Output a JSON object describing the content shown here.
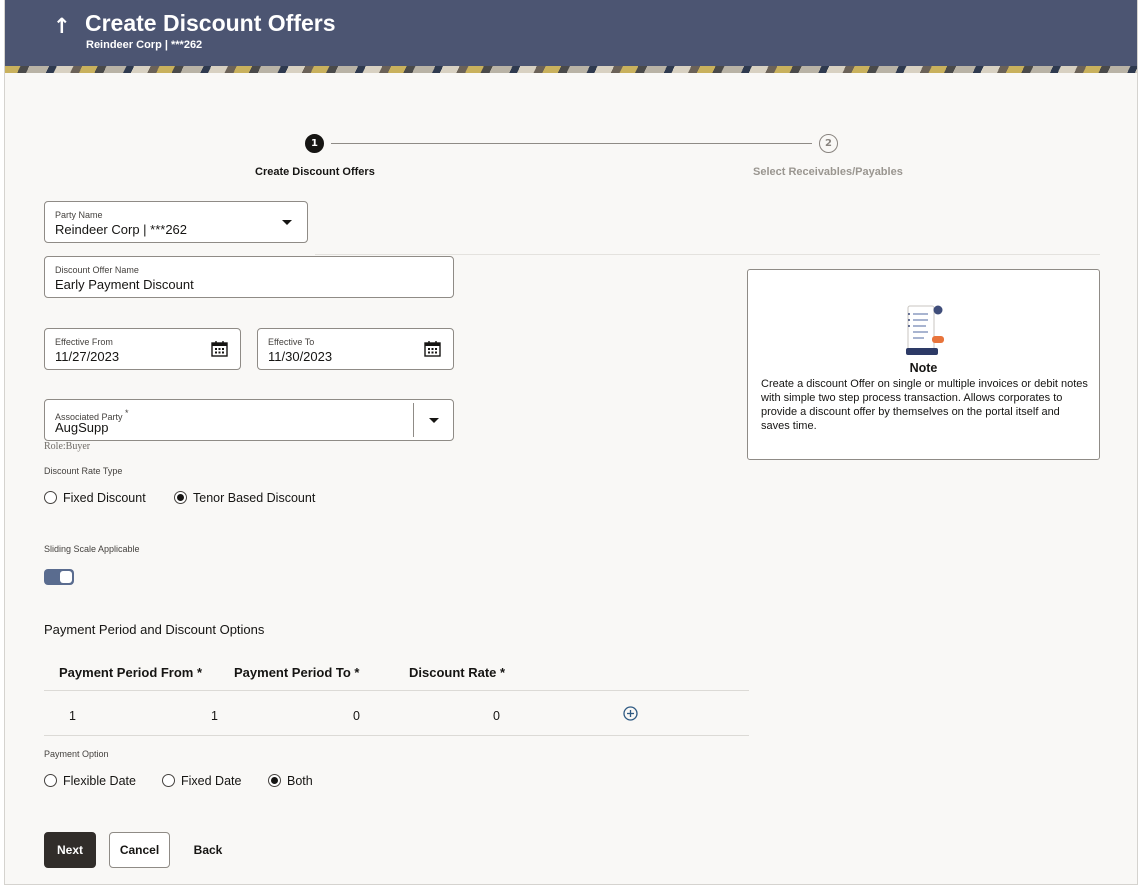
{
  "header": {
    "back_icon": "up-arrow-icon",
    "back_glyph": "↑",
    "title": "Create Discount Offers",
    "subtitle": "Reindeer Corp | ***262",
    "background": "#4c5572"
  },
  "stepper": {
    "steps": [
      {
        "number": "1",
        "label": "Create Discount Offers",
        "state": "active"
      },
      {
        "number": "2",
        "label": "Select Receivables/Payables",
        "state": "inactive"
      }
    ]
  },
  "form": {
    "party_name": {
      "label": "Party Name",
      "value": "Reindeer Corp | ***262"
    },
    "discount_offer_name": {
      "label": "Discount Offer Name",
      "value": "Early Payment Discount"
    },
    "effective_from": {
      "label": "Effective From",
      "value": "11/27/2023"
    },
    "effective_to": {
      "label": "Effective To",
      "value": "11/30/2023"
    },
    "associated_party": {
      "label": "Associated Party",
      "required_mark": "*",
      "value": "AugSupp",
      "role": "Role:Buyer"
    },
    "discount_rate_type": {
      "label": "Discount Rate Type",
      "options": [
        {
          "label": "Fixed Discount",
          "selected": false
        },
        {
          "label": "Tenor Based Discount",
          "selected": true
        }
      ]
    },
    "sliding_scale": {
      "label": "Sliding Scale Applicable",
      "enabled": true
    },
    "payment_period": {
      "title": "Payment Period and Discount Options",
      "columns": [
        "Payment Period From *",
        "Payment Period To *",
        "Discount Rate *"
      ],
      "rows": [
        {
          "index": "1",
          "from": "1",
          "to": "0",
          "rate": "0"
        }
      ],
      "add_icon": "plus-circle-icon"
    },
    "payment_option": {
      "label": "Payment Option",
      "options": [
        {
          "label": "Flexible Date",
          "selected": false
        },
        {
          "label": "Fixed Date",
          "selected": false
        },
        {
          "label": "Both",
          "selected": true
        }
      ]
    }
  },
  "buttons": {
    "next": "Next",
    "cancel": "Cancel",
    "back": "Back"
  },
  "note": {
    "icon": "document-note-icon",
    "title": "Note",
    "text": "Create a discount Offer on single or multiple invoices or debit notes with simple two step process transaction. Allows corporates to provide a discount offer by themselves on the portal itself and saves time."
  },
  "colors": {
    "accent": "#5a6c8f",
    "primary_button": "#312d2a",
    "header": "#4c5572"
  }
}
